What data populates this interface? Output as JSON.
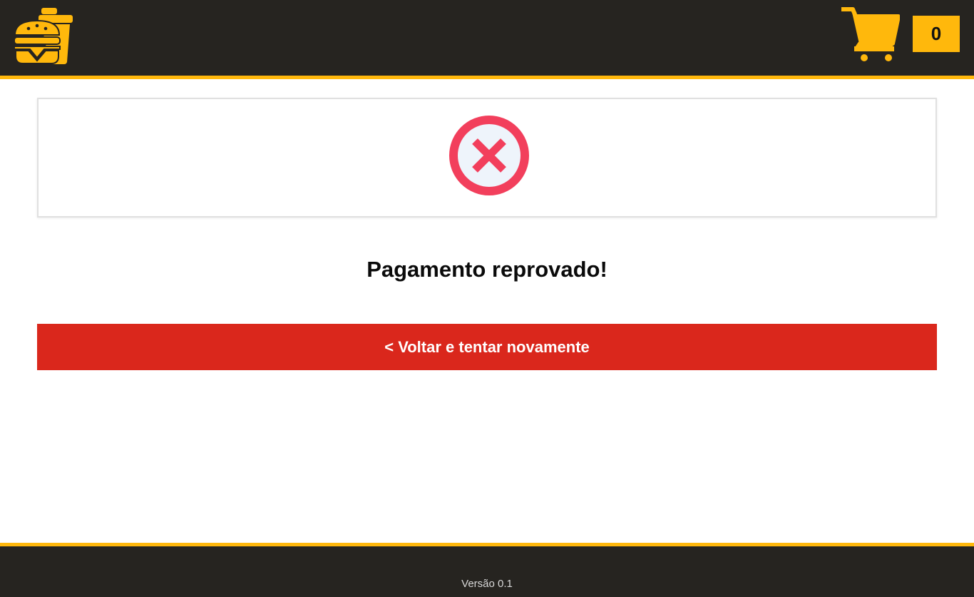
{
  "header": {
    "logo_icon": "burger-and-drink-icon",
    "cart_icon": "shopping-cart-icon",
    "cart_count": "0"
  },
  "status": {
    "icon": "error-x-circle-icon",
    "title": "Pagamento reprovado!"
  },
  "actions": {
    "retry_label": "< Voltar e tentar novamente"
  },
  "footer": {
    "version": "Versão 0.1"
  },
  "colors": {
    "header_bg": "#262420",
    "accent": "#ffb80c",
    "error": "#f23f5c",
    "button": "#da271c"
  }
}
